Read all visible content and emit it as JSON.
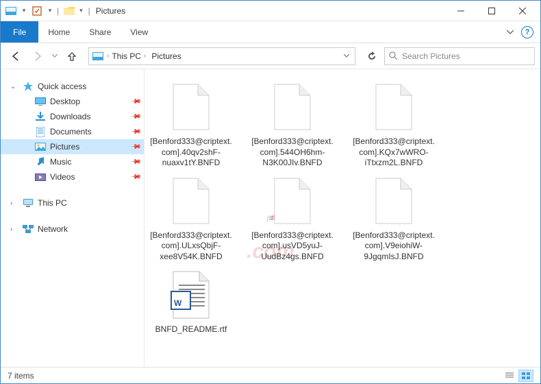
{
  "window": {
    "title": "Pictures",
    "quick_access_dropdown": "▾"
  },
  "ribbon": {
    "file": "File",
    "tabs": [
      "Home",
      "Share",
      "View"
    ]
  },
  "nav": {
    "breadcrumb": [
      "This PC",
      "Pictures"
    ],
    "search_placeholder": "Search Pictures"
  },
  "sidebar": {
    "quick_access": {
      "label": "Quick access",
      "items": [
        {
          "label": "Desktop",
          "icon": "desktop"
        },
        {
          "label": "Downloads",
          "icon": "downloads"
        },
        {
          "label": "Documents",
          "icon": "documents"
        },
        {
          "label": "Pictures",
          "icon": "pictures",
          "selected": true
        },
        {
          "label": "Music",
          "icon": "music"
        },
        {
          "label": "Videos",
          "icon": "videos"
        }
      ]
    },
    "this_pc": {
      "label": "This PC"
    },
    "network": {
      "label": "Network"
    }
  },
  "files": [
    {
      "name": "[Benford333@criptext.com].40qv2shF-nuaxv1tY.BNFD",
      "type": "unknown"
    },
    {
      "name": "[Benford333@criptext.com].544OH6hm-N3K00JIv.BNFD",
      "type": "unknown"
    },
    {
      "name": "[Benford333@criptext.com].KQx7wWRO-iTtxzm2L.BNFD",
      "type": "unknown"
    },
    {
      "name": "[Benford333@criptext.com].ULxsQbjF-xee8V54K.BNFD",
      "type": "unknown"
    },
    {
      "name": "[Benford333@criptext.com].usVD5yuJ-UudBz4gs.BNFD",
      "type": "unknown"
    },
    {
      "name": "[Benford333@criptext.com].V9eiohiW-9JgqmIsJ.BNFD",
      "type": "unknown"
    },
    {
      "name": "BNFD_README.rtf",
      "type": "rtf"
    }
  ],
  "status": {
    "count_label": "7 items"
  },
  "watermark": {
    "pc": "pc",
    "risk": "risk",
    "sub": ".com"
  }
}
